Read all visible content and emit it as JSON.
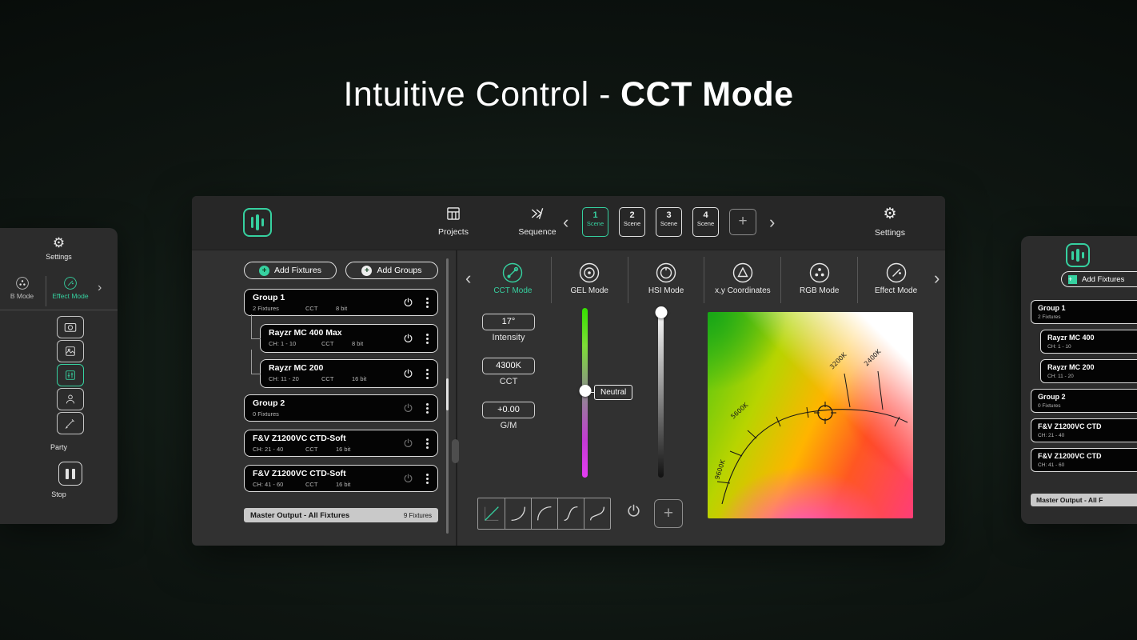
{
  "title": {
    "regular": "Intuitive Control -",
    "bold": "CCT Mode"
  },
  "colors": {
    "accent": "#36D1A0"
  },
  "icons": {
    "gear": "⚙",
    "chevron_left": "‹",
    "chevron_right": "›",
    "plus": "+"
  },
  "topbar": {
    "projects": "Projects",
    "sequence": "Sequence",
    "settings": "Settings",
    "scenes": [
      {
        "num": "1",
        "label": "Scene"
      },
      {
        "num": "2",
        "label": "Scene"
      },
      {
        "num": "3",
        "label": "Scene"
      },
      {
        "num": "4",
        "label": "Scene"
      }
    ]
  },
  "fixtures_panel": {
    "add_fixtures": "Add Fixtures",
    "add_groups": "Add Groups",
    "rows": [
      {
        "name": "Group 1",
        "detail": "2 Fixtures",
        "mode": "CCT",
        "bits": "8 bit"
      },
      {
        "name": "Rayzr MC 400 Max",
        "detail": "CH: 1 - 10",
        "mode": "CCT",
        "bits": "8 bit"
      },
      {
        "name": "Rayzr MC 200",
        "detail": "CH: 11 - 20",
        "mode": "CCT",
        "bits": "16 bit"
      },
      {
        "name": "Group 2",
        "detail": "0 Fixtures",
        "mode": "",
        "bits": ""
      },
      {
        "name": "F&V Z1200VC CTD-Soft",
        "detail": "CH: 21 - 40",
        "mode": "CCT",
        "bits": "16 bit"
      },
      {
        "name": "F&V Z1200VC CTD-Soft",
        "detail": "CH: 41 - 60",
        "mode": "CCT",
        "bits": "16 bit"
      }
    ],
    "master": {
      "name": "Master Output - All Fixtures",
      "count": "9 Fixtures"
    }
  },
  "modes": [
    {
      "label": "CCT Mode"
    },
    {
      "label": "GEL Mode"
    },
    {
      "label": "HSI Mode"
    },
    {
      "label": "x,y Coordinates"
    },
    {
      "label": "RGB Mode"
    },
    {
      "label": "Effect Mode"
    }
  ],
  "cct": {
    "intensity_value": "17°",
    "intensity_label": "Intensity",
    "cct_value": "4300K",
    "cct_label": "CCT",
    "gm_value": "+0.00",
    "gm_label": "G/M",
    "gm_handle": "Neutral"
  },
  "diagram": {
    "l9600": "9600K",
    "l5600": "5600K",
    "l3200": "3200K",
    "l2400": "2400K"
  },
  "left_preview": {
    "settings": "Settings",
    "mode_partial": "B Mode",
    "mode_active": "Effect Mode",
    "party": "Party",
    "stop": "Stop"
  },
  "right_preview": {
    "add_fixtures": "Add Fixtures",
    "rows": [
      {
        "name": "Group 1",
        "detail": "2 Fixtures"
      },
      {
        "name": "Rayzr MC 400",
        "detail": "CH: 1 - 10"
      },
      {
        "name": "Rayzr MC 200",
        "detail": "CH: 11 - 20"
      },
      {
        "name": "Group 2",
        "detail": "0 Fixtures"
      },
      {
        "name": "F&V Z1200VC CTD",
        "detail": "CH: 21 - 40"
      },
      {
        "name": "F&V Z1200VC CTD",
        "detail": "CH: 41 - 60"
      }
    ],
    "master": "Master Output - All F"
  }
}
